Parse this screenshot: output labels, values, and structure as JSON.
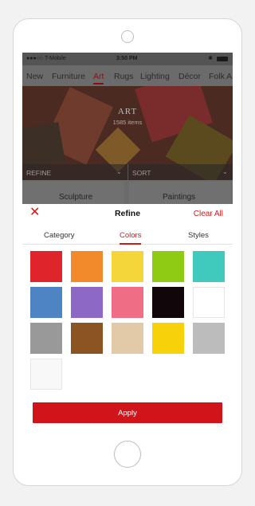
{
  "status_bar": {
    "carrier": "●●●○○ T-Mobile",
    "time": "3:50 PM"
  },
  "category_nav": {
    "items": [
      "New",
      "Furniture",
      "Art",
      "Rugs",
      "Lighting",
      "Décor",
      "Folk A"
    ],
    "active": "Art"
  },
  "hero": {
    "title": "ART",
    "count": "1585 items",
    "refine_label": "REFINE",
    "sort_label": "SORT"
  },
  "subcategories": [
    "Sculpture",
    "Paintings"
  ],
  "refine_sheet": {
    "title": "Refine",
    "clear_label": "Clear All",
    "tabs": [
      "Category",
      "Colors",
      "Styles"
    ],
    "active_tab": "Colors",
    "colors": [
      "#e0242c",
      "#f28a2c",
      "#f4d63b",
      "#8fcb14",
      "#40c9bd",
      "#4e84c3",
      "#8d68c4",
      "#f06d86",
      "#110609",
      "#ffffff",
      "#999999",
      "#8c5422",
      "#e2c9a7",
      "#f7d20a",
      "#bcbcbc",
      "#f8f8f8"
    ],
    "apply_label": "Apply"
  }
}
